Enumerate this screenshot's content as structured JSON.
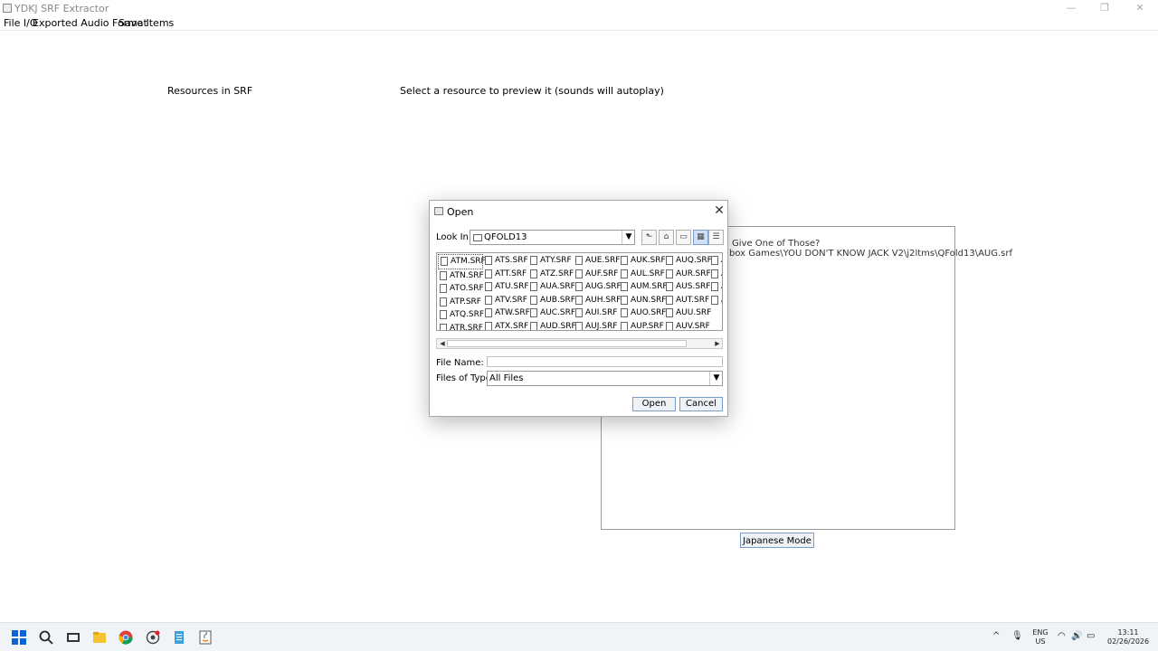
{
  "window": {
    "title": "YDKJ SRF Extractor",
    "minimize_glyph": "—",
    "maximize_glyph": "❐",
    "close_glyph": "✕"
  },
  "menu": [
    "File I/O",
    "Exported Audio Format",
    "Save Items"
  ],
  "main": {
    "resources_label": "Resources in SRF",
    "preview_label": "Select a resource to preview it  (sounds will autoplay)",
    "preview_lines": [
      "Give One of Those?",
      "box Games\\YOU DON'T KNOW JACK V2\\j2ltms\\QFold13\\AUG.srf"
    ],
    "japanese_button": "Japanese Mode"
  },
  "dialog": {
    "title": "Open",
    "close_glyph": "✕",
    "look_in_label": "Look In:",
    "look_in_value": "QFOLD13",
    "toolbar_icons": [
      "up-folder-icon",
      "home-icon",
      "new-folder-icon",
      "list-view-icon",
      "details-view-icon"
    ],
    "files": [
      [
        "ATM.SRF",
        "ATN.SRF",
        "ATO.SRF",
        "ATP.SRF",
        "ATQ.SRF",
        "ATR.SRF"
      ],
      [
        "ATS.SRF",
        "ATT.SRF",
        "ATU.SRF",
        "ATV.SRF",
        "ATW.SRF",
        "ATX.SRF"
      ],
      [
        "ATY.SRF",
        "ATZ.SRF",
        "AUA.SRF",
        "AUB.SRF",
        "AUC.SRF",
        "AUD.SRF"
      ],
      [
        "AUE.SRF",
        "AUF.SRF",
        "AUG.SRF",
        "AUH.SRF",
        "AUI.SRF",
        "AUJ.SRF"
      ],
      [
        "AUK.SRF",
        "AUL.SRF",
        "AUM.SRF",
        "AUN.SRF",
        "AUO.SRF",
        "AUP.SRF"
      ],
      [
        "AUQ.SRF",
        "AUR.SRF",
        "AUS.SRF",
        "AUT.SRF",
        "AUU.SRF",
        "AUV.SRF"
      ],
      [
        "A",
        "A",
        "A",
        "A",
        "",
        ""
      ]
    ],
    "file_name_label": "File Name:",
    "file_name_value": "",
    "files_of_type_label": "Files of Type:",
    "files_of_type_value": "All Files",
    "open_button": "Open",
    "cancel_button": "Cancel"
  },
  "taskbar": {
    "apps": [
      "start-icon",
      "search-icon",
      "task-view-icon",
      "file-explorer-icon",
      "chrome-icon",
      "app-icon",
      "notepad-icon",
      "java-icon"
    ],
    "tray_lang": [
      "ENG",
      "US"
    ],
    "time": "13:11",
    "date": "02/26/2026"
  }
}
